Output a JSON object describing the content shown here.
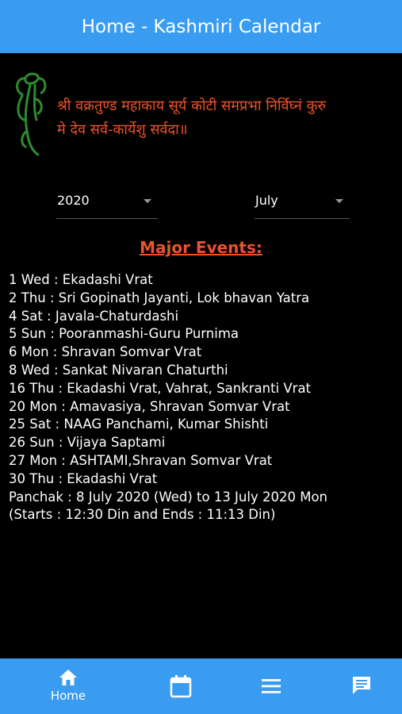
{
  "app": {
    "title": "Home - Kashmiri Calendar"
  },
  "mantra": {
    "line1": "श्री वक्रतुण्ड महाकाय सूर्य कोटी समप्रभा निर्विघ्नं कुरु",
    "line2": "मे देव सर्व-कार्येशु सर्वदा॥"
  },
  "filters": {
    "year": "2020",
    "month": "July"
  },
  "events": {
    "heading": "Major Events:",
    "items": [
      "1 Wed : Ekadashi Vrat",
      "2 Thu : Sri Gopinath Jayanti, Lok bhavan Yatra",
      "4 Sat : Javala-Chaturdashi",
      "5 Sun : Pooranmashi-Guru Purnima",
      "6 Mon : Shravan Somvar Vrat",
      "8 Wed : Sankat Nivaran Chaturthi",
      "16 Thu : Ekadashi Vrat, Vahrat, Sankranti Vrat",
      "20 Mon : Amavasiya, Shravan Somvar Vrat",
      "25 Sat : NAAG Panchami, Kumar Shishti",
      "26 Sun : Vijaya Saptami",
      "27 Mon : ASHTAMI,Shravan Somvar Vrat",
      "30 Thu : Ekadashi Vrat",
      "Panchak : 8 July 2020 (Wed) to 13 July 2020 Mon",
      "(Starts : 12:30 Din and Ends : 11:13 Din)"
    ]
  },
  "bottom_nav": {
    "home_label": "Home",
    "icons": [
      "home-icon",
      "calendar-icon",
      "menu-icon",
      "chat-icon"
    ]
  },
  "colors": {
    "accent": "#3a9cf1",
    "mantra": "#e8542b",
    "heading": "#e8542b",
    "ganesha": "#2e8b2e"
  }
}
